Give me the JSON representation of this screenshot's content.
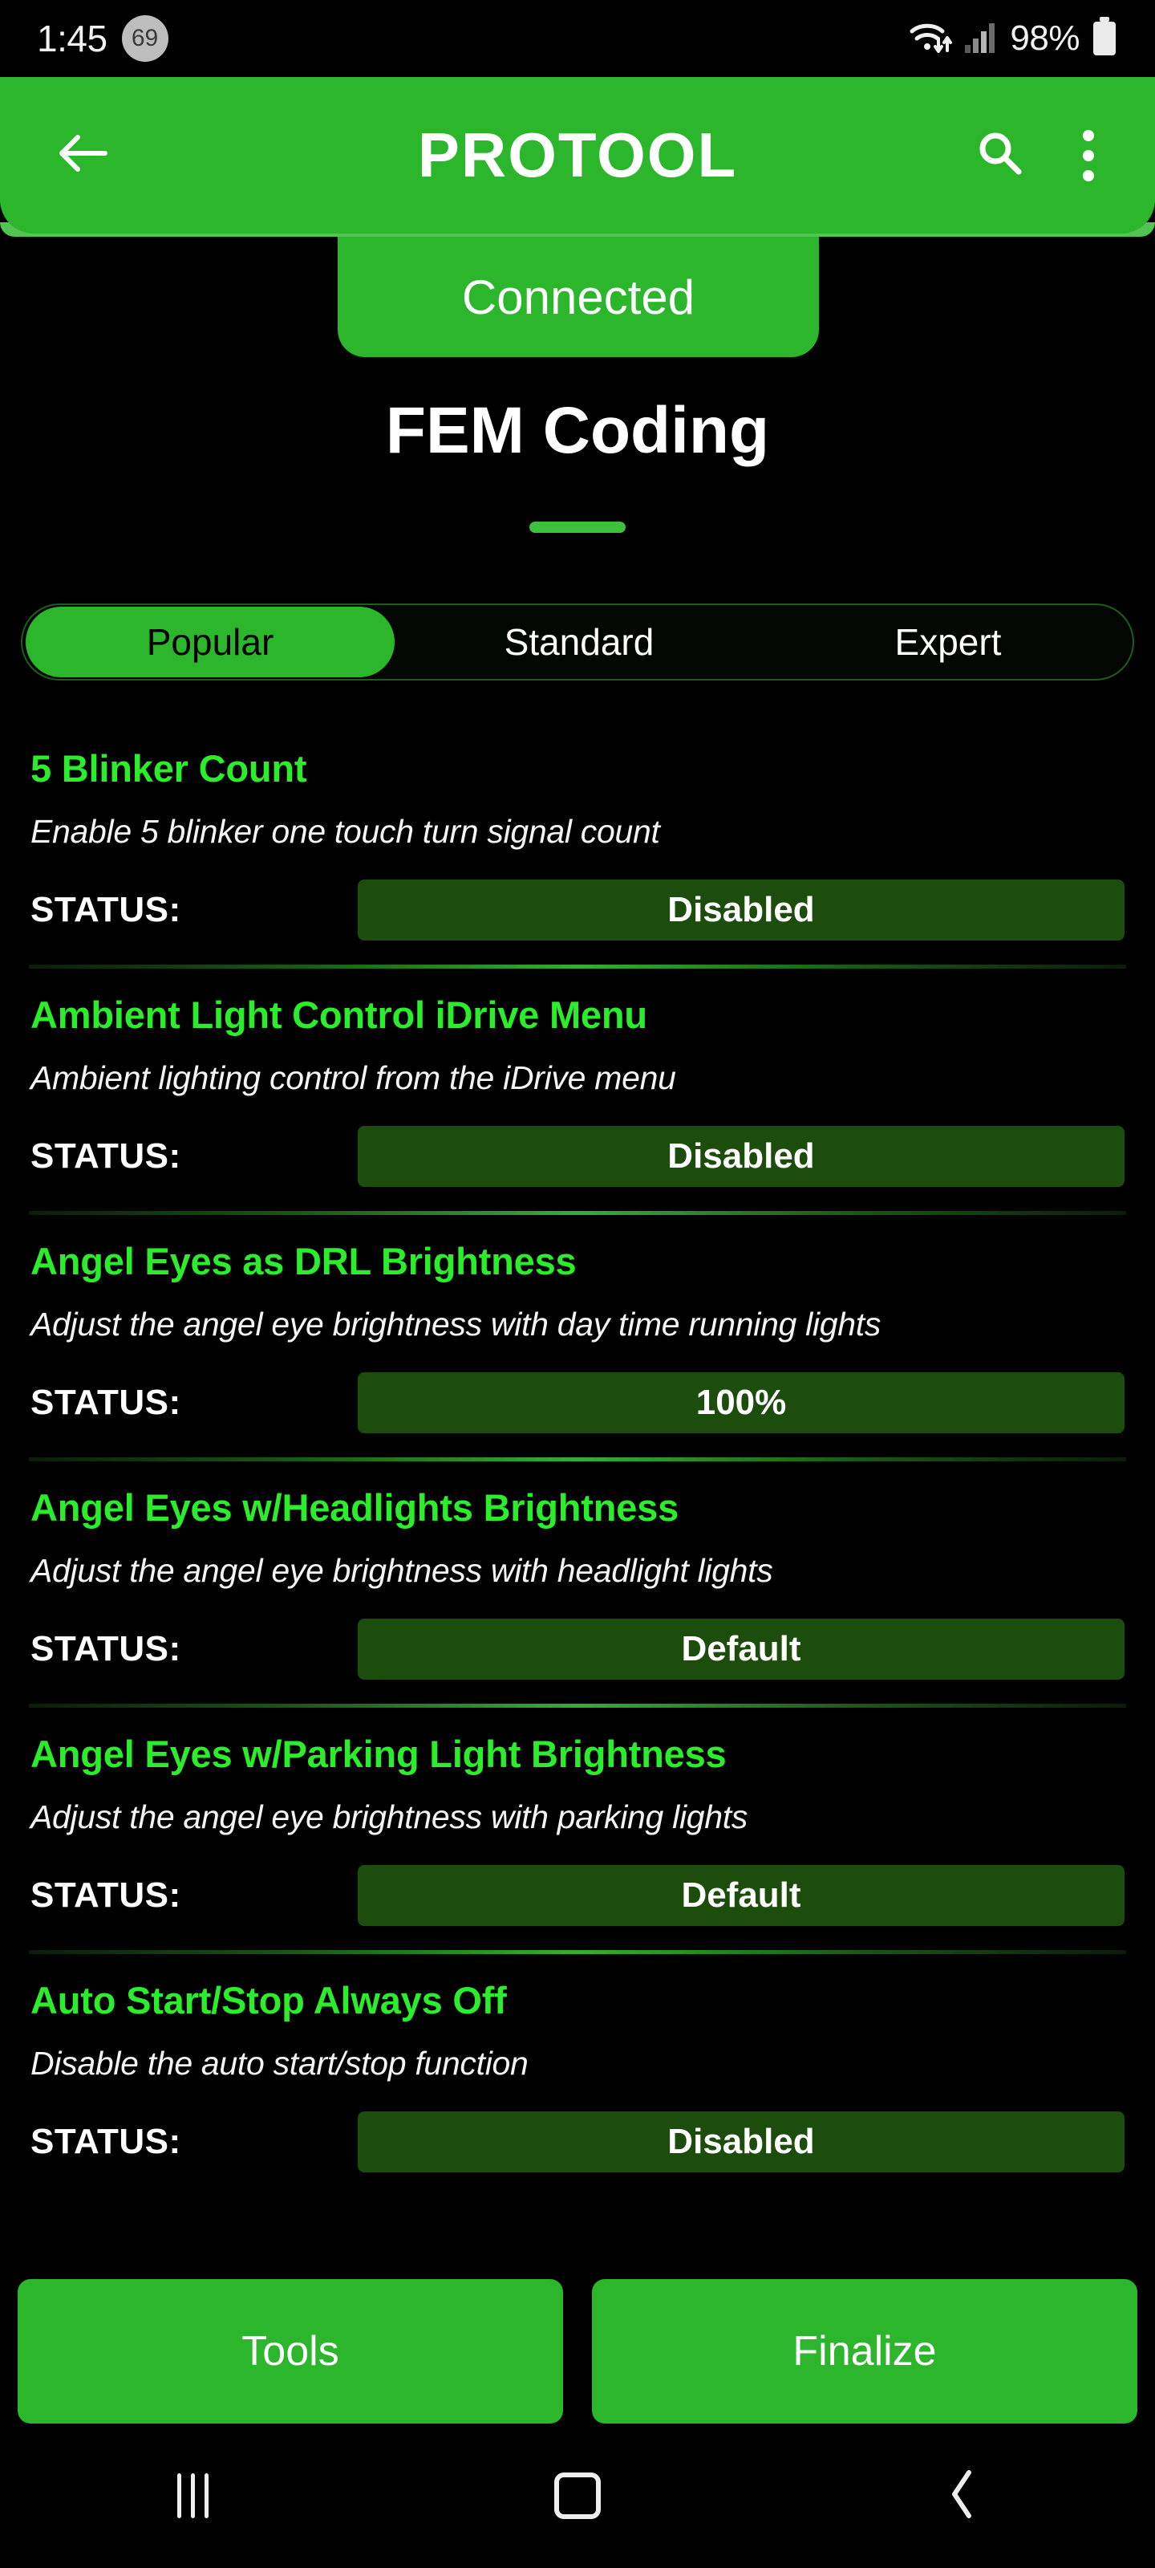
{
  "status_bar": {
    "time": "1:45",
    "notification_badge": "69",
    "wifi_icon": "wifi-data-icon",
    "signal_icon": "cellular-signal-icon",
    "battery_percent": "98%",
    "battery_icon": "battery-full-icon"
  },
  "app_bar": {
    "back_icon": "arrow-left-icon",
    "title": "PROTOOL",
    "search_icon": "search-icon",
    "overflow_icon": "more-vertical-icon"
  },
  "connection": {
    "status": "Connected"
  },
  "page": {
    "title": "FEM Coding"
  },
  "tabs": {
    "items": [
      {
        "label": "Popular",
        "active": true
      },
      {
        "label": "Standard",
        "active": false
      },
      {
        "label": "Expert",
        "active": false
      }
    ]
  },
  "list": {
    "status_label": "STATUS:",
    "items": [
      {
        "title": "5 Blinker Count",
        "description": "Enable 5 blinker one touch turn signal count",
        "status": "Disabled"
      },
      {
        "title": "Ambient Light Control iDrive Menu",
        "description": "Ambient lighting control from the iDrive menu",
        "status": "Disabled"
      },
      {
        "title": "Angel Eyes as DRL Brightness",
        "description": "Adjust the angel eye brightness with day time running lights",
        "status": "100%"
      },
      {
        "title": "Angel Eyes w/Headlights Brightness",
        "description": "Adjust the angel eye brightness with headlight lights",
        "status": "Default"
      },
      {
        "title": "Angel Eyes w/Parking Light Brightness",
        "description": "Adjust the angel eye brightness with parking lights",
        "status": "Default"
      },
      {
        "title": "Auto Start/Stop Always Off",
        "description": "Disable the auto start/stop function",
        "status": "Disabled"
      }
    ]
  },
  "bottom_actions": {
    "tools_label": "Tools",
    "finalize_label": "Finalize"
  },
  "android_nav": {
    "recents_icon": "recents-icon",
    "home_icon": "home-icon",
    "back_icon": "back-chevron-icon"
  },
  "colors": {
    "brand_green": "#2cb62c",
    "title_green": "#2bed2b",
    "status_box_green": "#1d4d0d",
    "background": "#000000"
  }
}
